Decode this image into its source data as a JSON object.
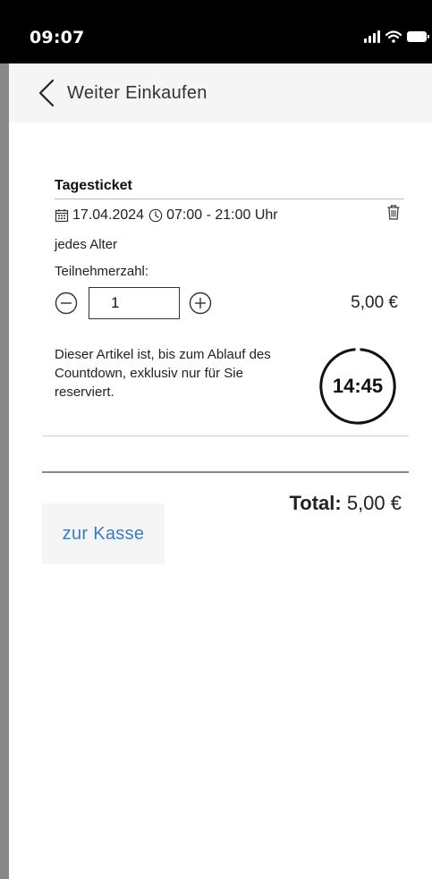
{
  "status_bar": {
    "time": "09:07",
    "icons": [
      "signal-icon",
      "wifi-icon",
      "battery-icon"
    ]
  },
  "nav": {
    "back_icon": "chevron-left-icon",
    "back_label": "Weiter Einkaufen"
  },
  "cart_item": {
    "title": "Tagesticket",
    "date_icon": "calendar-icon",
    "date": "17.04.2024",
    "time_icon": "clock-icon",
    "time_range": "07:00 - 21:00 Uhr",
    "delete_icon": "trash-icon",
    "age": "jedes Alter",
    "participants_label": "Teilnehmerzahl:",
    "quantity": "1",
    "price": "5,00 €",
    "reservation_note": "Dieser Artikel ist, bis zum Ablauf des Countdown, exklusiv nur für Sie reserviert.",
    "countdown": "14:45"
  },
  "summary": {
    "total_label": "Total:",
    "total_value": "5,00 €",
    "checkout_label": "zur Kasse"
  },
  "colors": {
    "accent": "#3a7cc0",
    "status_bar_bg": "#000000",
    "nav_bg": "#f5f5f5",
    "side_strip": "#888888"
  }
}
